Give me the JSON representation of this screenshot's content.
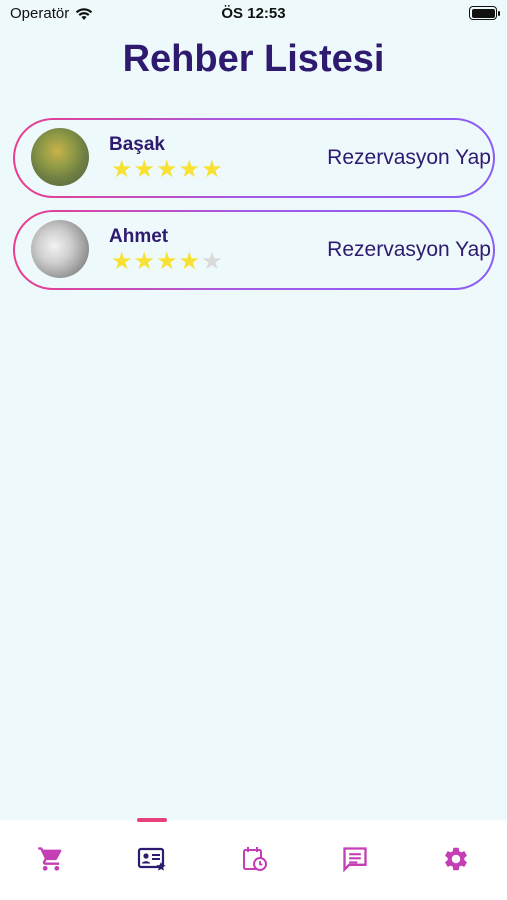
{
  "status_bar": {
    "carrier": "Operatör",
    "time": "ÖS 12:53"
  },
  "page_title": "Rehber Listesi",
  "guides": [
    {
      "name": "Başak",
      "rating": 5,
      "max_rating": 5,
      "action_label": "Rezervasyon Yap"
    },
    {
      "name": "Ahmet",
      "rating": 4,
      "max_rating": 5,
      "action_label": "Rezervasyon Yap"
    }
  ],
  "bottom_nav": {
    "items": [
      {
        "icon": "cart-icon",
        "active": false
      },
      {
        "icon": "guide-card-icon",
        "active": true
      },
      {
        "icon": "calendar-clock-icon",
        "active": false
      },
      {
        "icon": "message-icon",
        "active": false
      },
      {
        "icon": "settings-gear-icon",
        "active": false
      }
    ],
    "accent_color": "#E8407A",
    "active_color": "#2E1A6E",
    "inactive_color": "#C43FB5"
  }
}
